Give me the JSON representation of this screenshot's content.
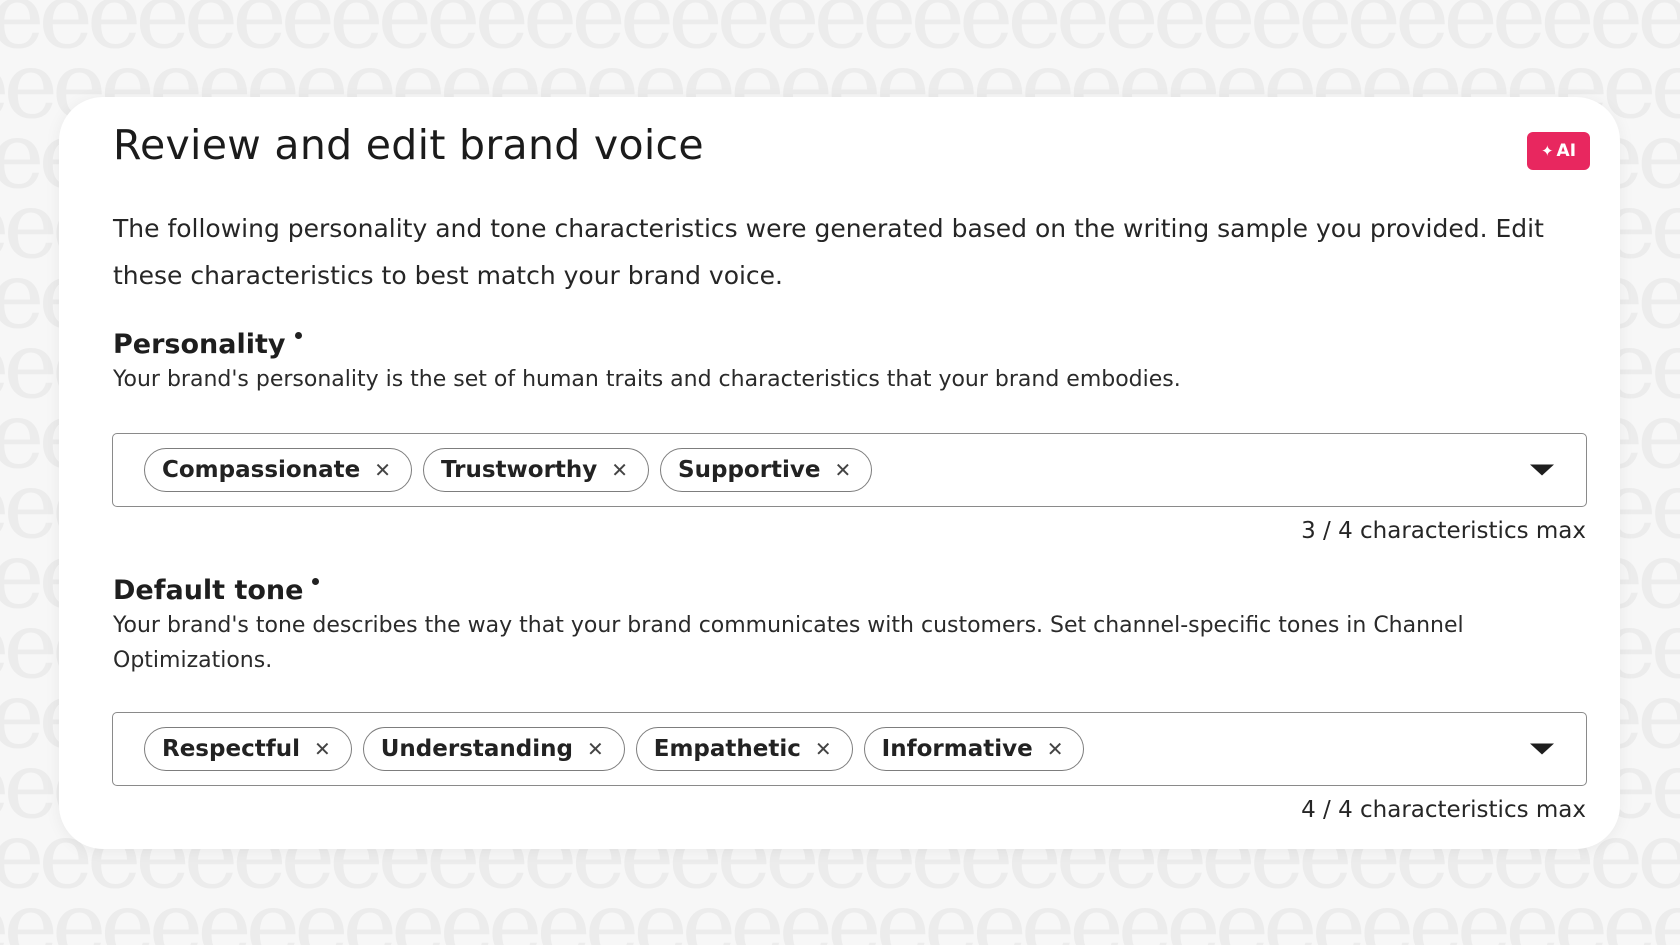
{
  "header": {
    "title": "Review and edit brand voice",
    "ai_badge_label": "AI",
    "ai_badge_icon": "sparkle-icon"
  },
  "intro": "The following personality and tone characteristics were generated based on the writing sample you provided. Edit these characteristics to best match your brand voice.",
  "personality": {
    "label": "Personality",
    "description": "Your brand's personality is the set of human traits and characteristics that your brand embodies.",
    "chips": [
      "Compassionate",
      "Trustworthy",
      "Supportive"
    ],
    "counter": "3 / 4 characteristics max"
  },
  "tone": {
    "label": "Default tone",
    "description": "Your brand's tone describes the way that your brand communicates with customers. Set channel-specific tones in Channel Optimizations.",
    "chips": [
      "Respectful",
      "Understanding",
      "Empathetic",
      "Informative"
    ],
    "counter": "4 / 4 characteristics max"
  },
  "colors": {
    "accent": "#e8275f",
    "background": "#f7f7f7",
    "card": "#ffffff"
  }
}
